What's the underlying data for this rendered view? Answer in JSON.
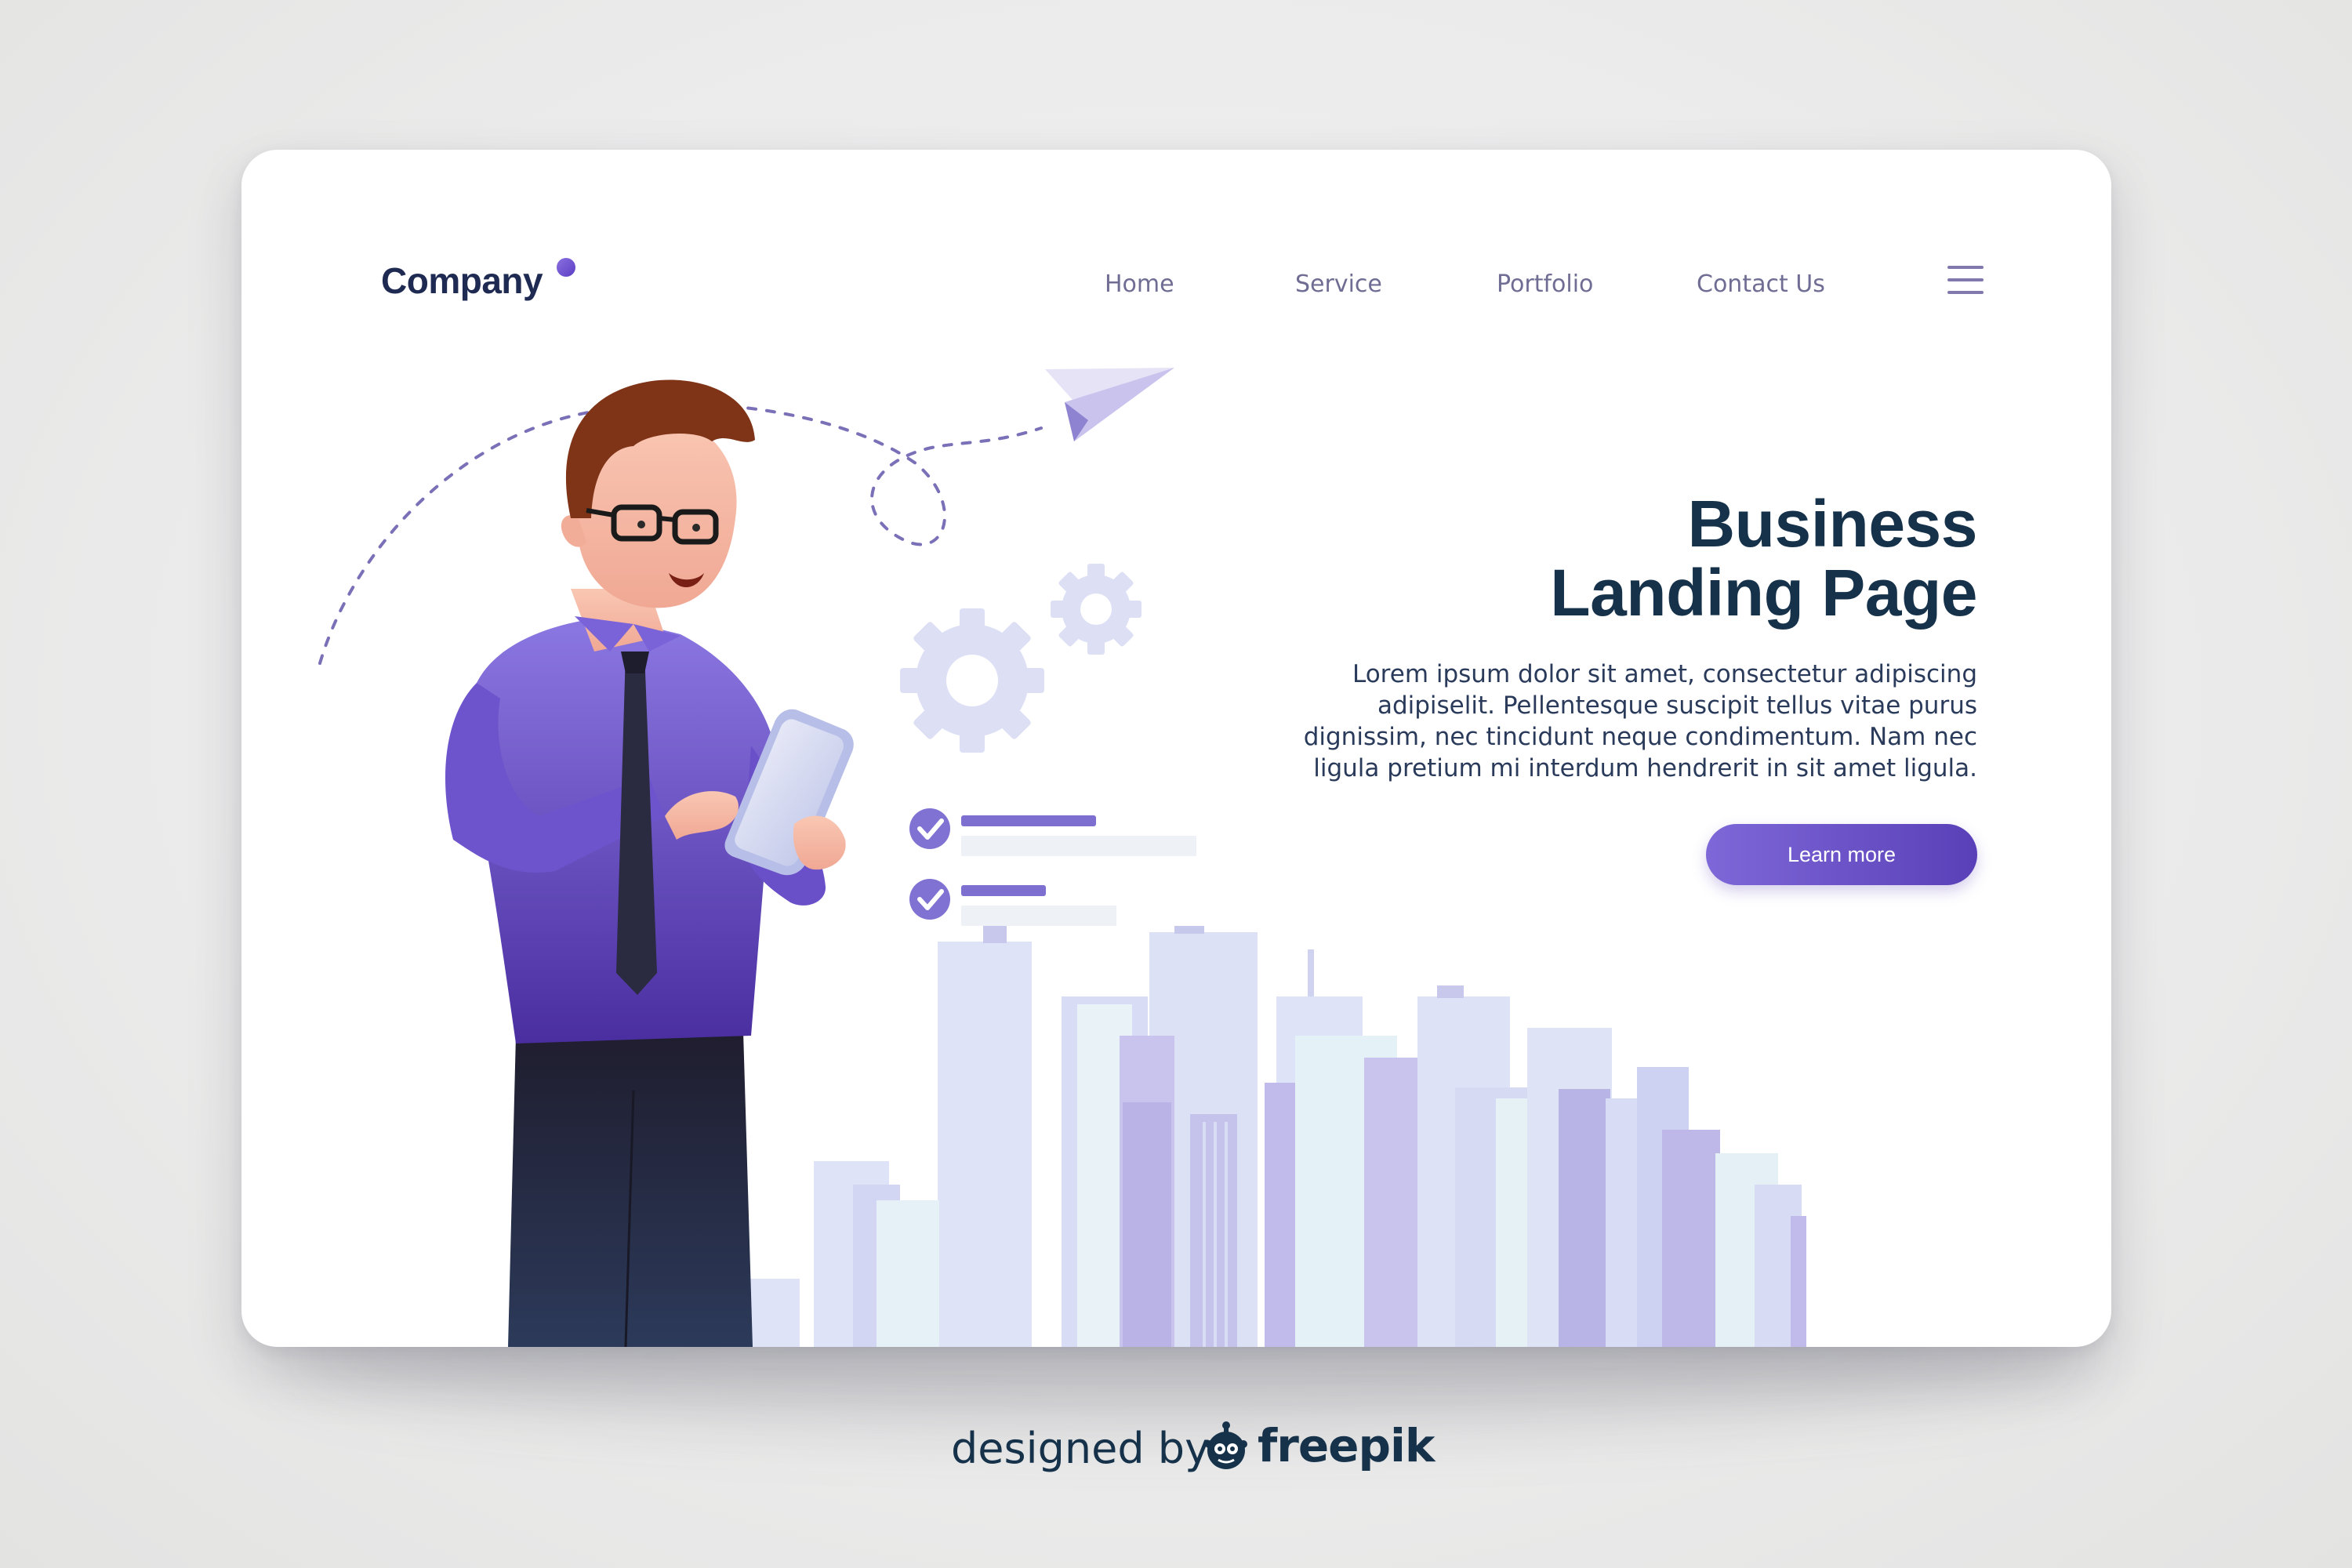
{
  "brand": {
    "logo_text": "Company"
  },
  "nav": {
    "items": [
      {
        "label": "Home"
      },
      {
        "label": "Service"
      },
      {
        "label": "Portfolio"
      },
      {
        "label": "Contact Us"
      }
    ],
    "menu_icon": "hamburger-menu-icon"
  },
  "hero": {
    "title_line1": "Business",
    "title_line2": "Landing Page",
    "description": "Lorem ipsum dolor sit amet, consectetur adipiscing adipiselit. Pellentesque suscipit tellus vitae purus dignissim, nec tincidunt neque condimentum. Nam nec ligula pretium mi interdum hendrerit in sit amet ligula.",
    "cta_label": "Learn more"
  },
  "illustration": {
    "icons": [
      "paper-plane-icon",
      "gear-icon",
      "check-circle-icon",
      "city-skyline",
      "businessman-with-tablet"
    ]
  },
  "credit": {
    "prefix": "designed by",
    "brand": "freepik",
    "icon": "freepik-logo-icon"
  },
  "colors": {
    "accent": "#6a50c8",
    "title": "#16324a",
    "nav_text": "#6f6d93",
    "skyline": "#dde2f6"
  }
}
